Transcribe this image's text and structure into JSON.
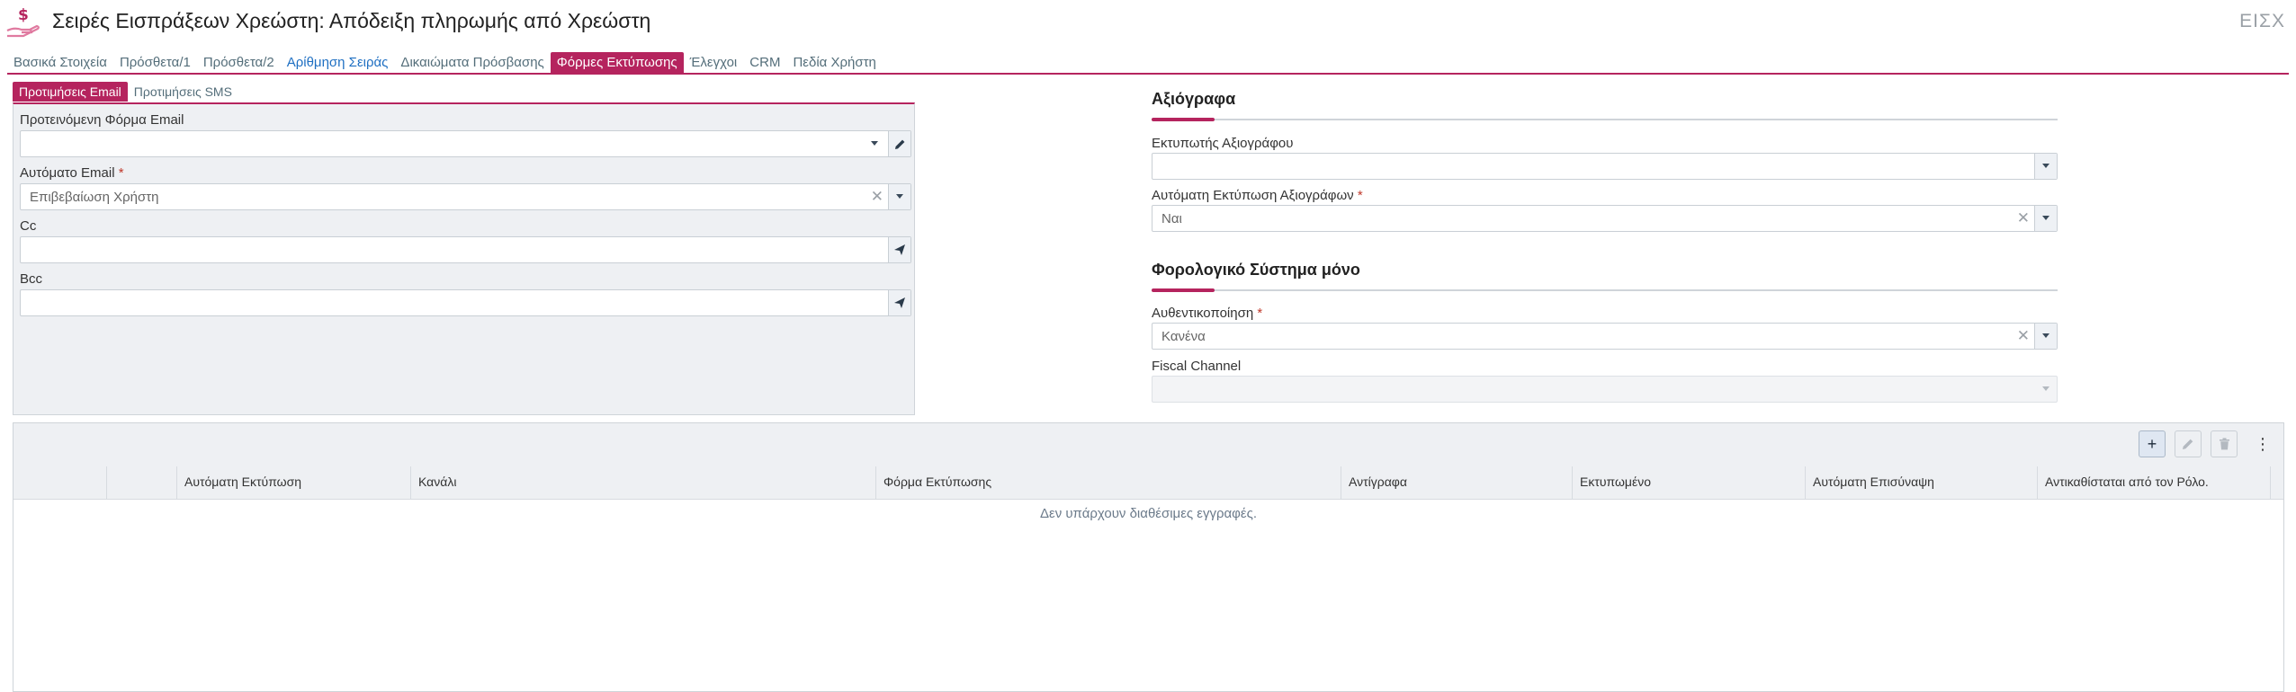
{
  "header": {
    "title": "Σειρές Εισπράξεων Χρεώστη: Απόδειξη πληρωμής από Χρεώστη",
    "code": "ΕΙΣΧ",
    "icon": "money-hand-icon"
  },
  "tabs": [
    {
      "label": "Βασικά Στοιχεία"
    },
    {
      "label": "Πρόσθετα/1"
    },
    {
      "label": "Πρόσθετα/2"
    },
    {
      "label": "Αρίθμηση Σειράς"
    },
    {
      "label": "Δικαιώματα Πρόσβασης"
    },
    {
      "label": "Φόρμες Εκτύπωσης"
    },
    {
      "label": "Έλεγχοι"
    },
    {
      "label": "CRM"
    },
    {
      "label": "Πεδία Χρήστη"
    }
  ],
  "subtabs": [
    {
      "label": "Προτιμήσεις Email"
    },
    {
      "label": "Προτιμήσεις SMS"
    }
  ],
  "email": {
    "template_label": "Προτεινόμενη Φόρμα Email",
    "template_value": "",
    "auto_label": "Αυτόματο Email",
    "auto_required": "*",
    "auto_value": "Επιβεβαίωση Χρήστη",
    "cc_label": "Cc",
    "cc_value": "",
    "bcc_label": "Bcc",
    "bcc_value": ""
  },
  "copies": {
    "section_title": "Αξιόγραφα",
    "printer_label": "Εκτυπωτής Αξιογράφου",
    "printer_value": "",
    "auto_print_label": "Αυτόματη Εκτύπωση Αξιογράφων",
    "auto_print_required": "*",
    "auto_print_value": "Ναι"
  },
  "fiscal": {
    "section_title": "Φορολογικό Σύστημα μόνο",
    "auth_label": "Αυθεντικοποίηση",
    "auth_required": "*",
    "auth_value": "Κανένα",
    "channel_label": "Fiscal Channel",
    "channel_value": ""
  },
  "grid": {
    "columns": [
      "",
      "",
      "Αυτόματη Εκτύπωση",
      "Κανάλι",
      "Φόρμα Εκτύπωσης",
      "Αντίγραφα",
      "Εκτυπωμένο",
      "Αυτόματη Επισύναψη",
      "Αντικαθίσταται από τον Ρόλο."
    ],
    "empty_message": "Δεν υπάρχουν διαθέσιμες εγγραφές.",
    "add_symbol": "+",
    "more_symbol": "⋮"
  },
  "colors": {
    "accent": "#b5245e",
    "link": "#1e6fc2",
    "panel_bg": "#eef0f3"
  }
}
